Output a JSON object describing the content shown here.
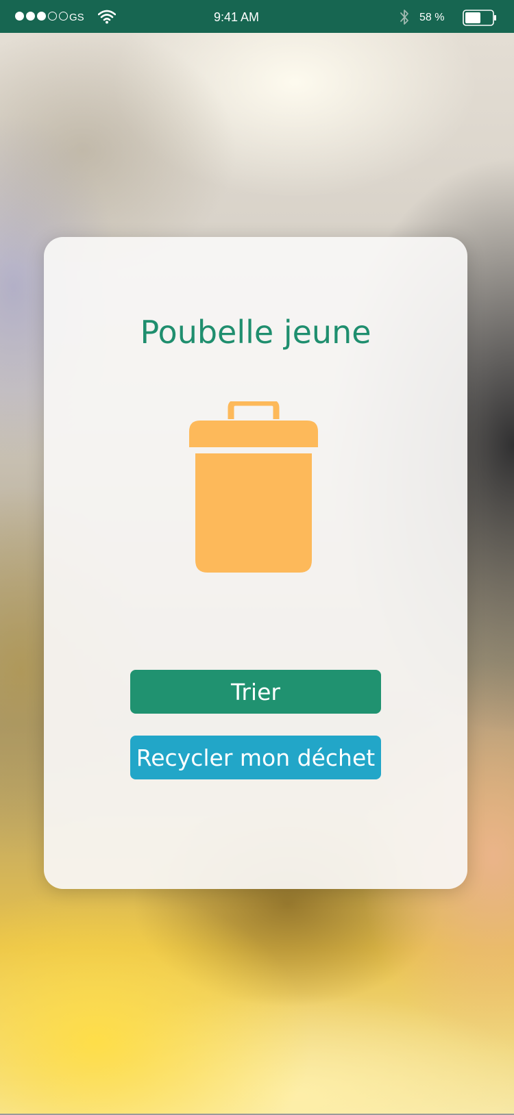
{
  "status_bar": {
    "carrier": "GS",
    "signal_strength": 3,
    "signal_max": 5,
    "time": "9:41 AM",
    "battery_percent": "58 %",
    "battery_level": 0.58,
    "icons": [
      "wifi-icon",
      "bluetooth-icon",
      "battery-icon"
    ]
  },
  "card": {
    "title": "Poubelle jeune",
    "icon": "trash-can-icon",
    "icon_color": "#FDB95A"
  },
  "buttons": {
    "sort_label": "Trier",
    "recycle_label": "Recycler mon déchet"
  },
  "colors": {
    "status_bar": "#176651",
    "title": "#1F8E6E",
    "sort_button": "#209270",
    "recycle_button": "#22A6C8"
  }
}
